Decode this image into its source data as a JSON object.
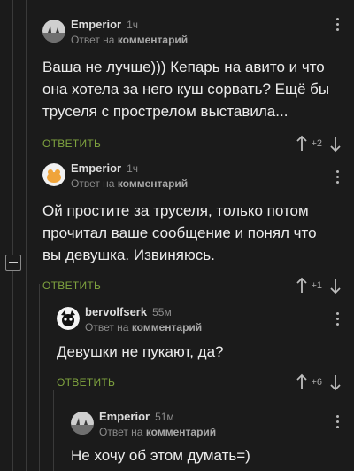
{
  "comments": [
    {
      "username": "Emperior",
      "time": "1ч",
      "reply_prefix": "Ответ на",
      "reply_link": "комментарий",
      "text": "Ваша не лучше))) Кепарь на авито и что она хотела за него куш сорвать? Ещё бы труселя с прострелом выставила...",
      "reply_label": "ОТВЕТИТЬ",
      "rating": "+2"
    },
    {
      "username": "Emperior",
      "time": "1ч",
      "reply_prefix": "Ответ на",
      "reply_link": "комментарий",
      "text": "Ой простите за труселя, только потом прочитал ваше сообщение и понял что вы девушка. Извиняюсь.",
      "reply_label": "ОТВЕТИТЬ",
      "rating": "+1"
    },
    {
      "username": "bervolfserk",
      "time": "55м",
      "reply_prefix": "Ответ на",
      "reply_link": "комментарий",
      "text": "Девушки не пукают, да?",
      "reply_label": "ОТВЕТИТЬ",
      "rating": "+6"
    },
    {
      "username": "Emperior",
      "time": "51м",
      "reply_prefix": "Ответ на",
      "reply_link": "комментарий",
      "text": "Не хочу об этом думать=)"
    }
  ],
  "icons": {
    "menu": "more-vertical-icon",
    "upvote": "arrow-up-icon",
    "downvote": "arrow-down-icon",
    "collapse": "minus-square-icon"
  },
  "colors": {
    "background": "#1b1b1b",
    "reply_button": "#7fa33f",
    "text": "#ececec",
    "muted": "#8c8c8c"
  }
}
